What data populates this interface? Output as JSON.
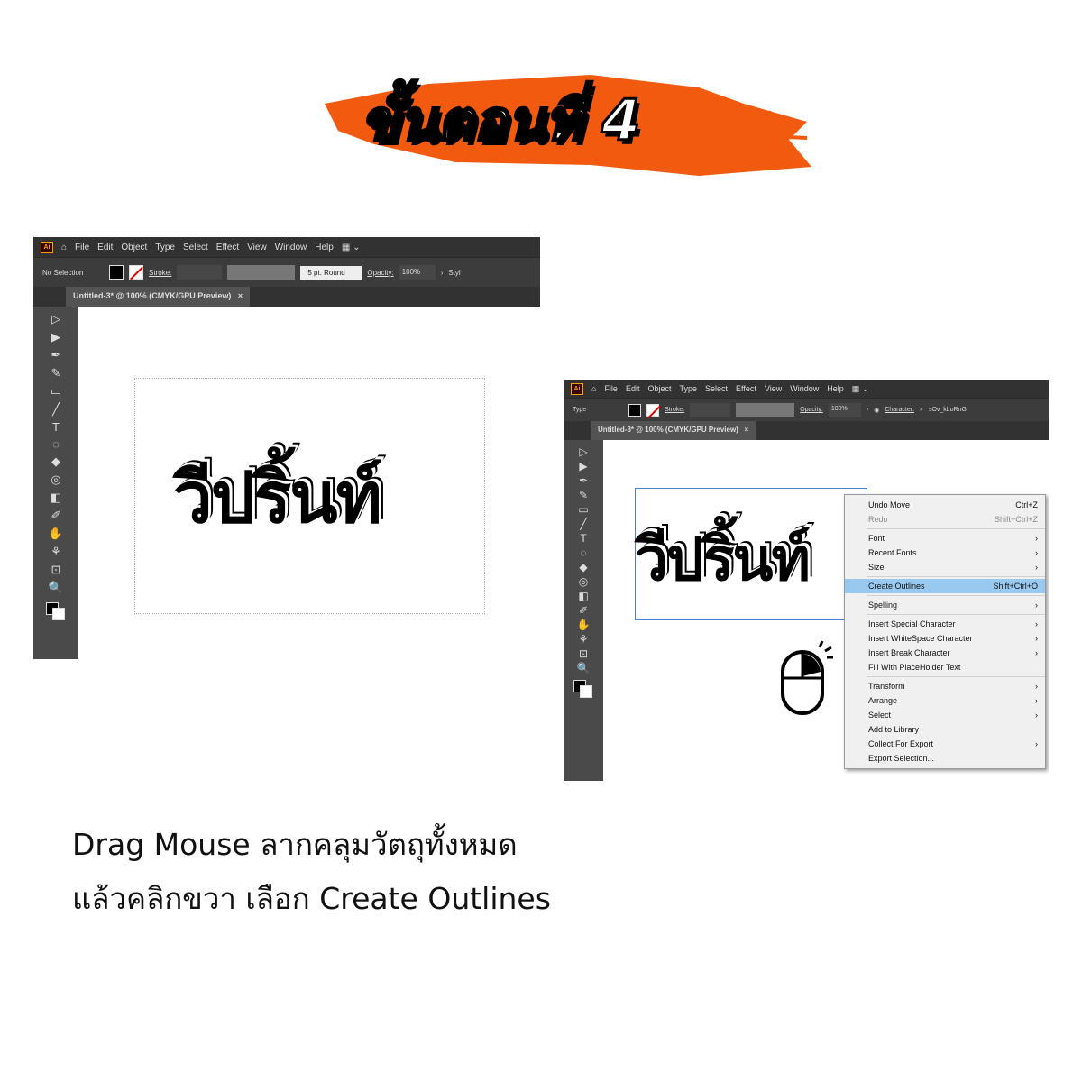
{
  "banner": {
    "title": "ขั้นตอนที่ 4",
    "brush_color": "#f15a0f"
  },
  "app": {
    "logo": "Ai",
    "menu": [
      "File",
      "Edit",
      "Object",
      "Type",
      "Select",
      "Effect",
      "View",
      "Window",
      "Help"
    ]
  },
  "window1": {
    "selection_label": "No Selection",
    "stroke_label": "Stroke:",
    "brush": "5 pt. Round",
    "opacity_label": "Opacity:",
    "opacity": "100%",
    "style_label": "Styl",
    "tab_title": "Untitled-3* @ 100% (CMYK/GPU Preview)",
    "artwork_text": "วีปริ้นท์"
  },
  "window2": {
    "selection_label": "Type",
    "stroke_label": "Stroke:",
    "opacity_label": "Opacity:",
    "opacity": "100%",
    "character_label": "Character:",
    "font_value": "sOv_kLoRnG",
    "tab_title": "Untitled-3* @ 100% (CMYK/GPU Preview)",
    "artwork_text": "วีปริ้นท์",
    "context_menu": [
      {
        "label": "Undo Move",
        "shortcut": "Ctrl+Z"
      },
      {
        "label": "Redo",
        "shortcut": "Shift+Ctrl+Z",
        "disabled": true
      },
      {
        "sep": true
      },
      {
        "label": "Font",
        "sub": true
      },
      {
        "label": "Recent Fonts",
        "sub": true
      },
      {
        "label": "Size",
        "sub": true
      },
      {
        "sep": true
      },
      {
        "label": "Create Outlines",
        "shortcut": "Shift+Ctrl+O",
        "highlighted": true
      },
      {
        "sep": true
      },
      {
        "label": "Spelling",
        "sub": true
      },
      {
        "sep": true
      },
      {
        "label": "Insert Special Character",
        "sub": true
      },
      {
        "label": "Insert WhiteSpace Character",
        "sub": true
      },
      {
        "label": "Insert Break Character",
        "sub": true
      },
      {
        "label": "Fill With PlaceHolder Text"
      },
      {
        "sep": true
      },
      {
        "label": "Transform",
        "sub": true
      },
      {
        "label": "Arrange",
        "sub": true
      },
      {
        "label": "Select",
        "sub": true
      },
      {
        "label": "Add to Library"
      },
      {
        "label": "Collect For Export",
        "sub": true
      },
      {
        "label": "Export Selection..."
      }
    ]
  },
  "caption": {
    "line1": "Drag Mouse ลากคลุมวัตถุทั้งหมด",
    "line2": "แล้วคลิกขวา เลือก Create Outlines"
  },
  "close_glyph": "×",
  "tools": [
    "▷",
    "▶",
    "✒",
    "✎",
    "▭",
    "╱",
    "T",
    "◌",
    "◆",
    "◎",
    "◧",
    "✐",
    "✋",
    "⚘",
    "⊡",
    "🔍"
  ]
}
